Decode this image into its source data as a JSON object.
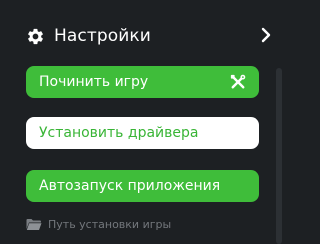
{
  "header": {
    "title": "Настройки",
    "icon": "gear-icon",
    "expand_icon": "chevron-right-icon"
  },
  "buttons": [
    {
      "label": "Починить игру",
      "icon": "tools-icon",
      "style": "green"
    },
    {
      "label": "Установить драйвера",
      "style": "white"
    },
    {
      "label": "Автозапуск приложения",
      "style": "green"
    }
  ],
  "footer": {
    "label": "Путь установки игры",
    "icon": "folder-icon"
  },
  "colors": {
    "background": "#1d2023",
    "accent_green": "#3fbd3a",
    "text_white": "#ffffff",
    "muted_text": "#73777c"
  }
}
